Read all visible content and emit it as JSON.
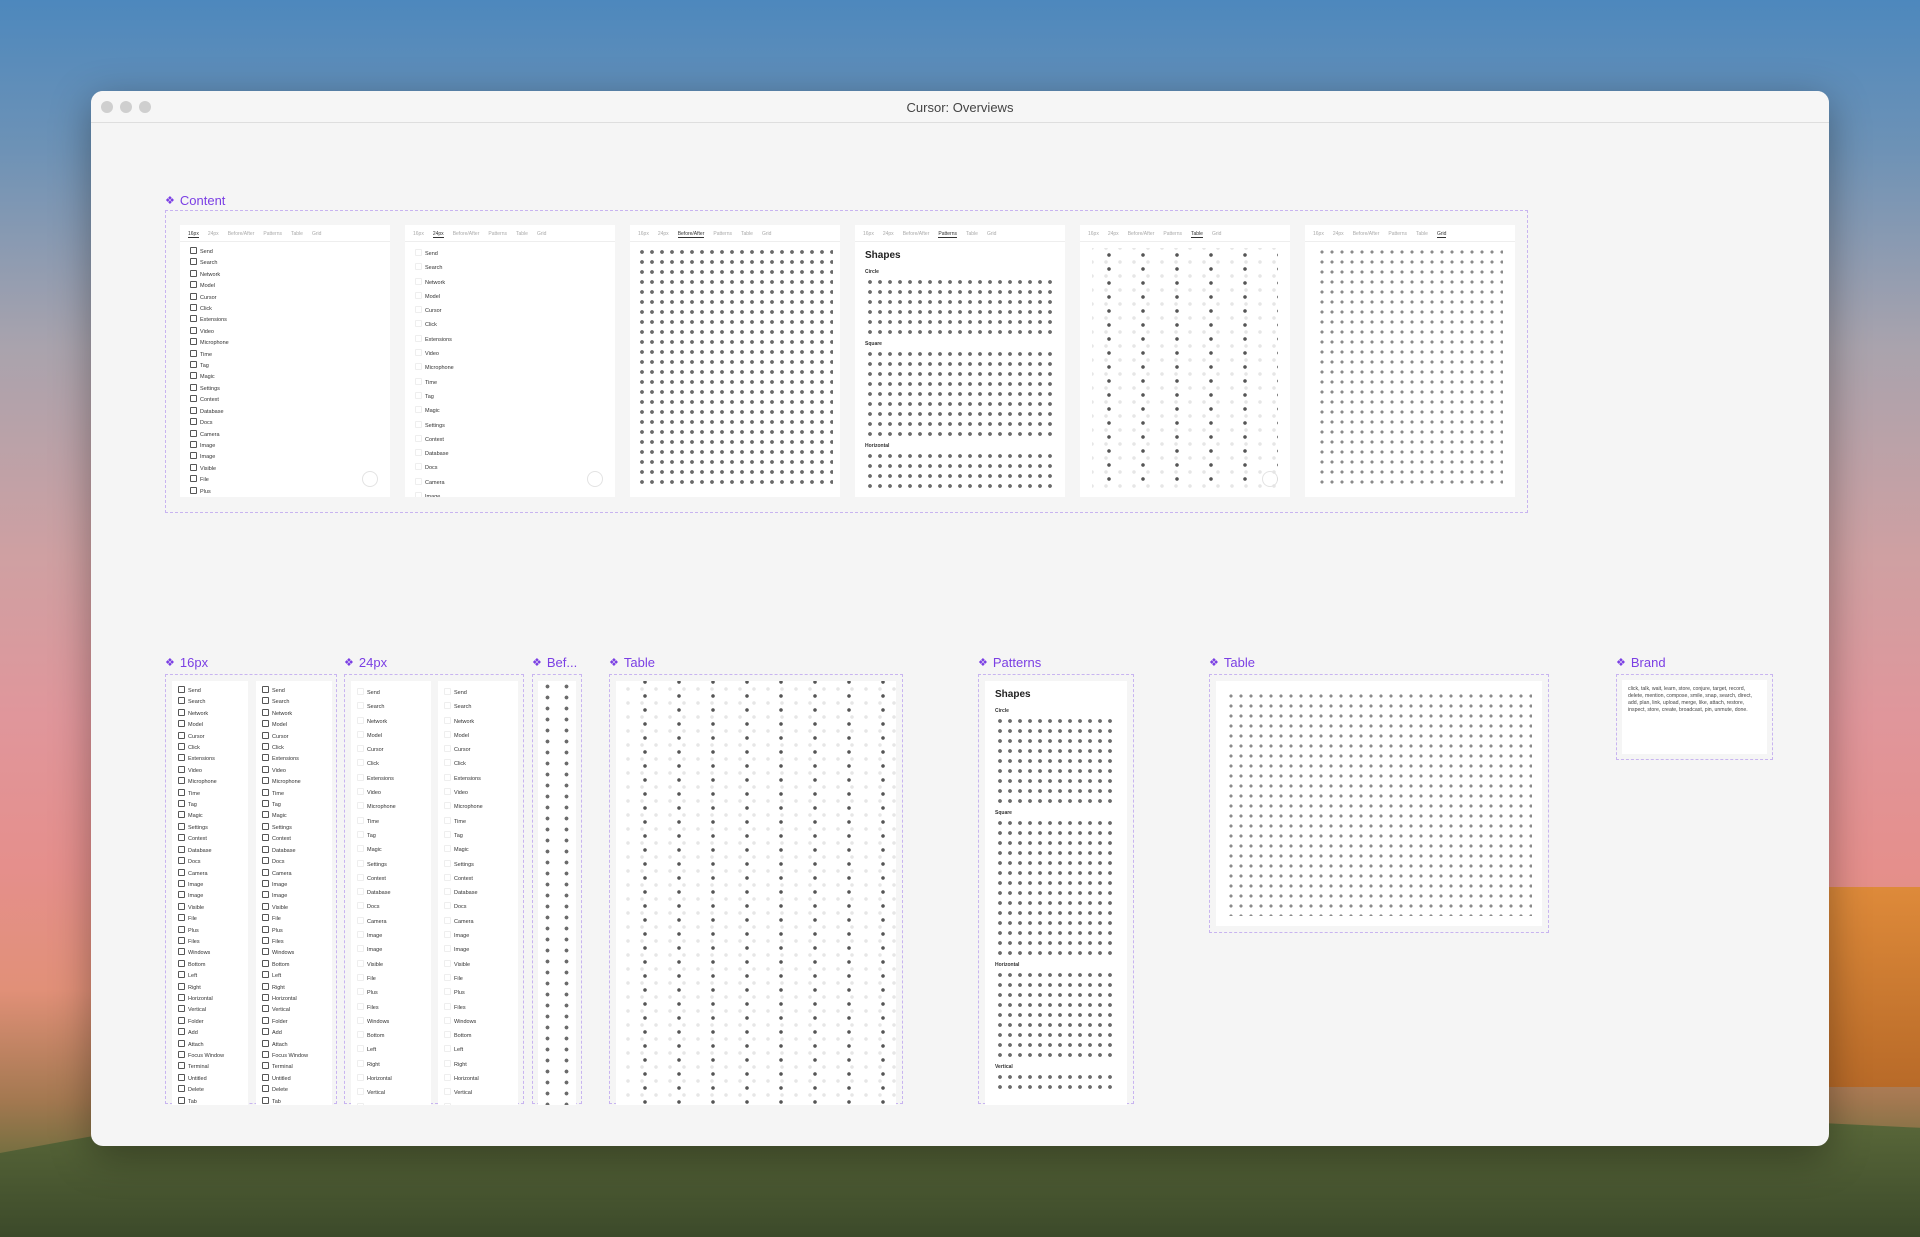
{
  "window": {
    "title": "Cursor: Overviews"
  },
  "frames": {
    "content": "Content",
    "px16": "16px",
    "px24": "24px",
    "before": "Bef...",
    "table": "Table",
    "patterns": "Patterns",
    "table2": "Table",
    "brand": "Brand"
  },
  "tabs": [
    "16px",
    "24px",
    "Before/After",
    "Patterns",
    "Table",
    "Grid"
  ],
  "icons_long": [
    "Send",
    "Search",
    "Network",
    "Model",
    "Cursor",
    "Click",
    "Extensions",
    "Video",
    "Microphone",
    "Time",
    "Tag",
    "Magic",
    "Settings",
    "Context",
    "Database",
    "Docs",
    "Camera",
    "Image",
    "Image",
    "Visible",
    "File",
    "Plus",
    "Files",
    "Windows",
    "Bottom",
    "Left",
    "Right",
    "Horizontal",
    "Vertical",
    "Folder",
    "Add",
    "Attach",
    "Focus Window",
    "Terminal",
    "Untitled",
    "Delete",
    "Tab"
  ],
  "icons_short": [
    "Send",
    "Search",
    "Network",
    "Model",
    "Cursor",
    "Click",
    "Extensions",
    "Video",
    "Microphone",
    "Time",
    "Tag",
    "Magic",
    "Settings",
    "Context",
    "Database",
    "Docs",
    "Camera",
    "Image",
    "Image",
    "Visible",
    "File",
    "Plus"
  ],
  "icons_24": [
    "Send",
    "Search",
    "Network",
    "Model",
    "Cursor",
    "Click",
    "Extensions",
    "Video",
    "Microphone",
    "Time",
    "Tag",
    "Magic",
    "Settings",
    "Context",
    "Database",
    "Docs",
    "Camera",
    "Image"
  ],
  "icons_24_long": [
    "Send",
    "Search",
    "Network",
    "Model",
    "Cursor",
    "Click",
    "Extensions",
    "Video",
    "Microphone",
    "Time",
    "Tag",
    "Magic",
    "Settings",
    "Context",
    "Database",
    "Docs",
    "Camera",
    "Image",
    "Image",
    "Visible",
    "File",
    "Plus",
    "Files",
    "Windows",
    "Bottom",
    "Left",
    "Right",
    "Horizontal",
    "Vertical",
    "Folder"
  ],
  "patterns": {
    "title": "Shapes",
    "circle": "Circle",
    "square": "Square",
    "horizontal": "Horizontal",
    "vertical": "Vertical"
  },
  "brand": {
    "text": "click, talk, wait, learn, store, conjure, target, record, delete, mention, compose, smile, snap, search, direct, add, plan, link, upload, merge, like, attach, restore, inspect, store, create, broadcast, pin, unmute, done."
  }
}
